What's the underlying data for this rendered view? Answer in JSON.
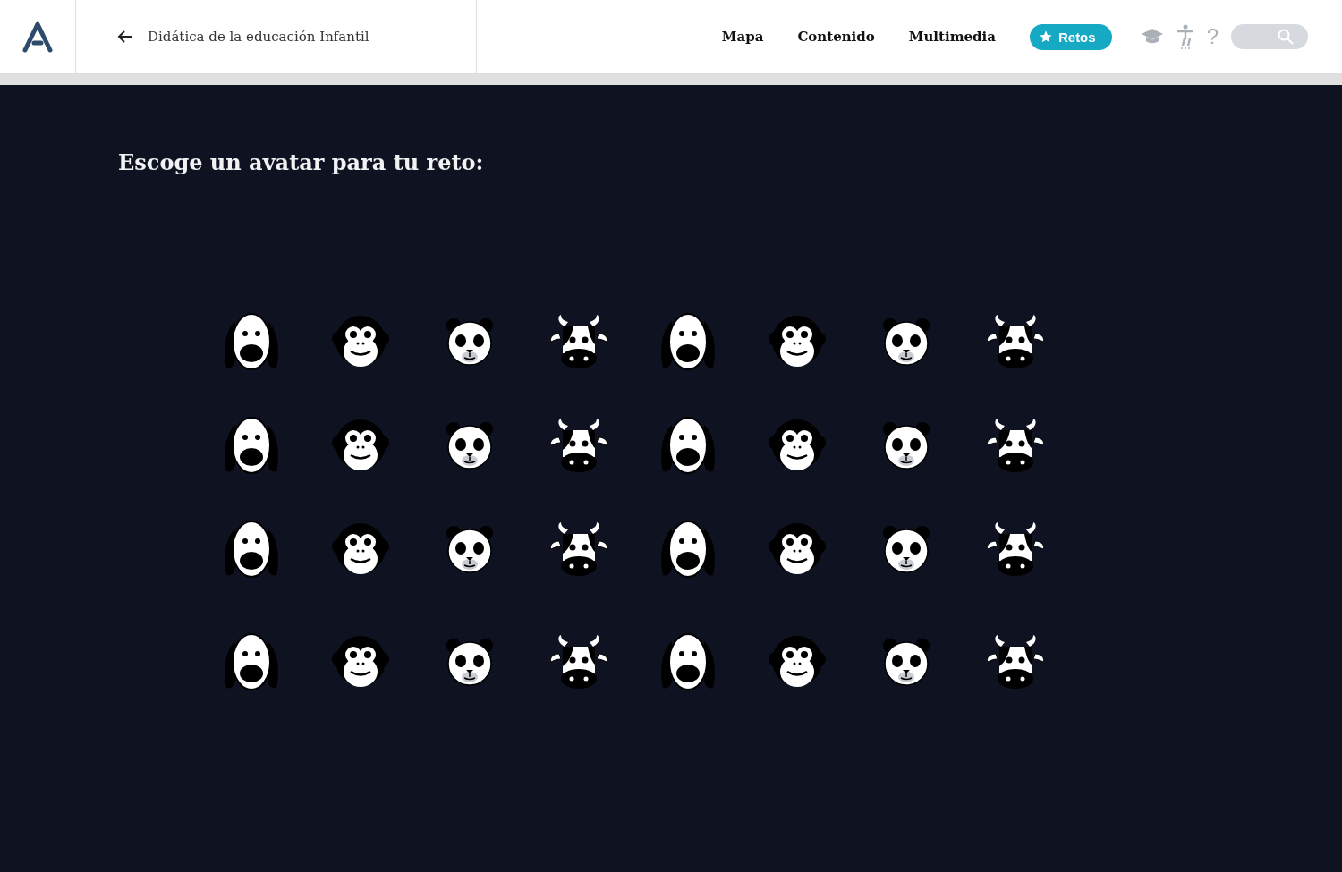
{
  "header": {
    "back_title": "Didática de la educación Infantil",
    "nav": [
      {
        "label": "Mapa",
        "selected": false
      },
      {
        "label": "Contenido",
        "selected": false
      },
      {
        "label": "Multimedia",
        "selected": false
      },
      {
        "label": "Retos",
        "selected": true
      }
    ],
    "help": "?"
  },
  "modal": {
    "title": "Escoge un avatar para tu reto:",
    "avatars": [
      {
        "kind": "dog"
      },
      {
        "kind": "monkey"
      },
      {
        "kind": "panda"
      },
      {
        "kind": "cow"
      },
      {
        "kind": "dog"
      },
      {
        "kind": "monkey"
      },
      {
        "kind": "panda"
      },
      {
        "kind": "cow"
      },
      {
        "kind": "dog"
      },
      {
        "kind": "monkey"
      },
      {
        "kind": "panda"
      },
      {
        "kind": "cow"
      },
      {
        "kind": "dog"
      },
      {
        "kind": "monkey"
      },
      {
        "kind": "panda"
      },
      {
        "kind": "cow"
      },
      {
        "kind": "dog"
      },
      {
        "kind": "monkey"
      },
      {
        "kind": "panda"
      },
      {
        "kind": "cow"
      },
      {
        "kind": "dog"
      },
      {
        "kind": "monkey"
      },
      {
        "kind": "panda"
      },
      {
        "kind": "cow"
      },
      {
        "kind": "dog"
      },
      {
        "kind": "monkey"
      },
      {
        "kind": "panda"
      },
      {
        "kind": "cow"
      },
      {
        "kind": "dog"
      },
      {
        "kind": "monkey"
      },
      {
        "kind": "panda"
      },
      {
        "kind": "cow"
      }
    ]
  }
}
